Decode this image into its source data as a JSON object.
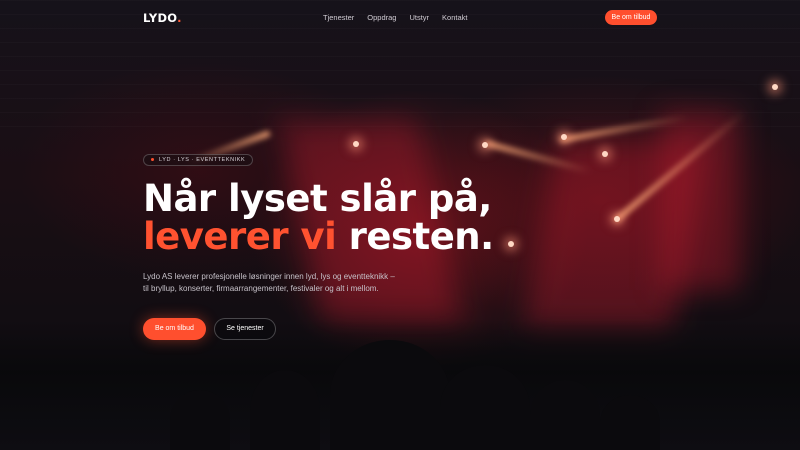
{
  "nav": {
    "logo_text": "LYDO",
    "logo_dot": ".",
    "links": [
      "Tjenester",
      "Oppdrag",
      "Utstyr",
      "Kontakt"
    ],
    "cta_label": "Be om tilbud"
  },
  "hero": {
    "tag": "LYD · LYS · EVENTTEKNIKK",
    "headline_line1": "Når lyset slår på,",
    "headline_accent": "leverer vi",
    "headline_rest": " resten.",
    "lead_line1": "Lydo AS leverer profesjonelle løsninger innen lyd, lys og eventteknikk –",
    "lead_line2": "til bryllup, konserter, firmaarrangementer, festivaler og alt i mellom.",
    "primary_button": "Be om tilbud",
    "secondary_button": "Se tjenester"
  },
  "colors": {
    "accent": "#ff4f2e",
    "background": "#0d0c10",
    "text": "#ffffff",
    "muted_text": "#c7c2c9"
  }
}
